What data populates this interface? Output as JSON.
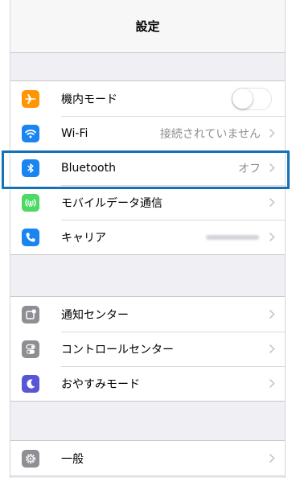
{
  "nav": {
    "title": "設定"
  },
  "colors": {
    "airplane": "#ff9500",
    "wifi": "#1a84f0",
    "bluetooth": "#1a84f0",
    "cellular": "#4cd964",
    "carrier": "#1a84f0",
    "notifications": "#8e8e93",
    "control_center": "#8e8e93",
    "do_not_disturb": "#5856d6",
    "general": "#8e8e93",
    "highlight": "#1572b6"
  },
  "group1": [
    {
      "label": "機内モード",
      "icon": "airplane-icon",
      "toggle": false
    },
    {
      "label": "Wi-Fi",
      "icon": "wifi-icon",
      "value": "接続されていません"
    },
    {
      "label": "Bluetooth",
      "icon": "bluetooth-icon",
      "value": "オフ"
    },
    {
      "label": "モバイルデータ通信",
      "icon": "cellular-icon"
    },
    {
      "label": "キャリア",
      "icon": "phone-icon"
    }
  ],
  "group2": [
    {
      "label": "通知センター",
      "icon": "notifications-icon"
    },
    {
      "label": "コントロールセンター",
      "icon": "control-center-icon"
    },
    {
      "label": "おやすみモード",
      "icon": "moon-icon"
    }
  ],
  "group3": [
    {
      "label": "一般",
      "icon": "gear-icon"
    }
  ]
}
